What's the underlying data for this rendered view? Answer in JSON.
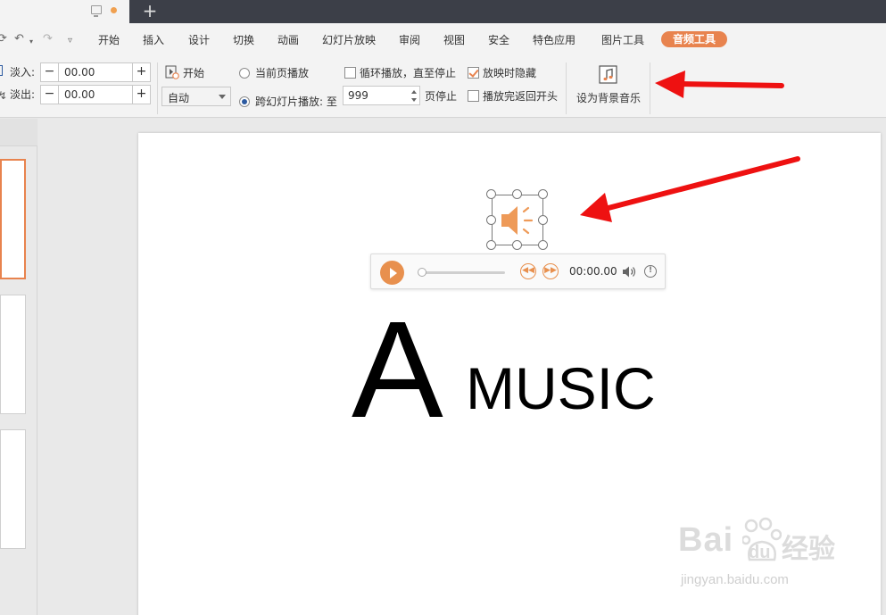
{
  "menu": {
    "items": [
      "开始",
      "插入",
      "设计",
      "切换",
      "动画",
      "幻灯片放映",
      "审阅",
      "视图",
      "安全",
      "特色应用",
      "图片工具"
    ],
    "active_tab": "音频工具"
  },
  "ribbon": {
    "fade_in_label": "淡入:",
    "fade_in_value": "00.00",
    "fade_out_label": "淡出:",
    "fade_out_value": "00.00",
    "start_label": "开始",
    "start_mode": "自动",
    "play_current_page": "当前页播放",
    "play_across_slides": "跨幻灯片播放: 至",
    "across_slides_value": "999",
    "page_stop": "页停止",
    "loop_until_stop": "循环播放，直至停止",
    "rewind_after_play": "播放完返回开头",
    "hide_during_show": "放映时隐藏",
    "set_bg_music": "设为背景音乐",
    "colors": {
      "accent": "#e8834e",
      "arrow": "#ee1111"
    }
  },
  "slide": {
    "title_letter": "A",
    "title_word": "MUSIC",
    "player": {
      "time": "00:00.00",
      "progress": 0
    }
  },
  "watermark": {
    "logo": "Bai",
    "paw": "du",
    "brand_cn": "经验",
    "url": "jingyan.baidu.com"
  }
}
